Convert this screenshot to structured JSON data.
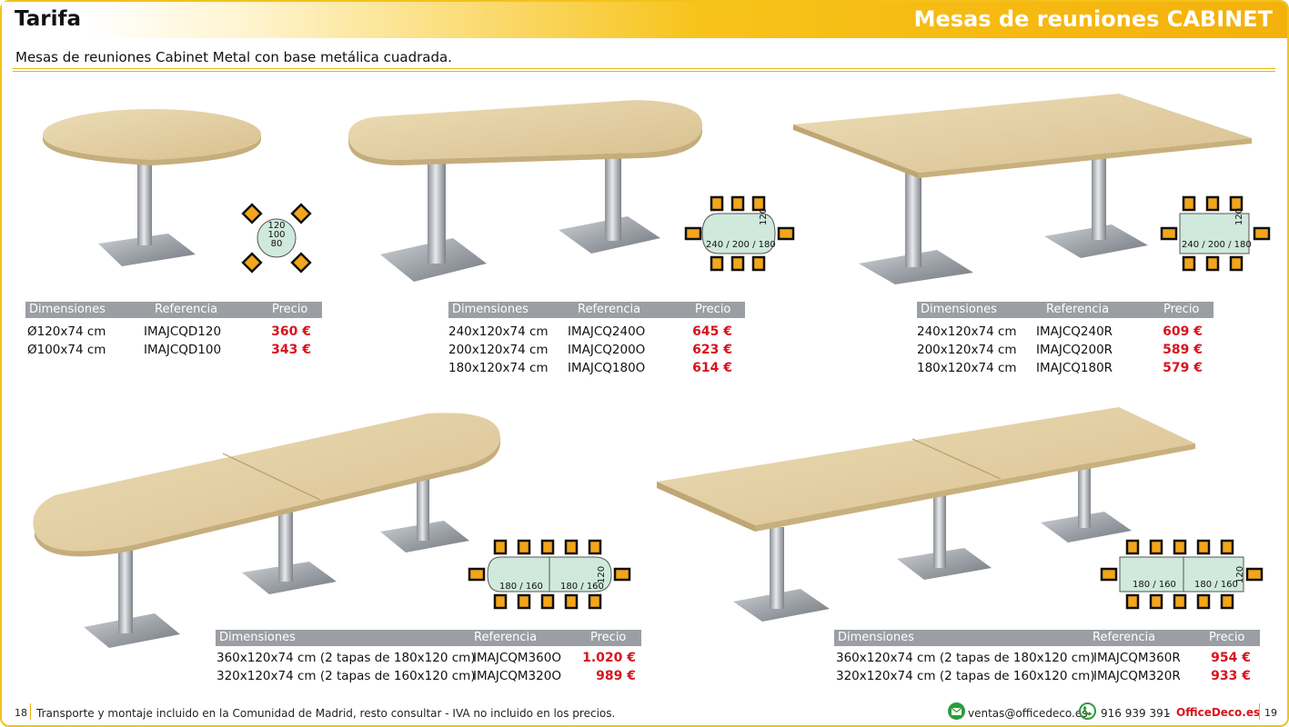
{
  "header": {
    "page_label": "Tarifa",
    "section_title": "Mesas de reuniones CABINET"
  },
  "subtitle": "Mesas de reuniones Cabinet Metal con base metálica cuadrada.",
  "table_headers": {
    "dimensions": "Dimensiones",
    "reference": "Referencia",
    "price": "Precio"
  },
  "products": [
    {
      "name": "round",
      "diagram_labels": [
        "120",
        "100",
        "80"
      ],
      "rows": [
        {
          "dim": "Ø120x74 cm",
          "ref": "IMAJCQD120",
          "price": "360 €"
        },
        {
          "dim": "Ø100x74 cm",
          "ref": "IMAJCQD100",
          "price": "343 €"
        }
      ]
    },
    {
      "name": "oval",
      "diagram_labels": [
        "240 / 200 / 180",
        "120"
      ],
      "rows": [
        {
          "dim": "240x120x74 cm",
          "ref": "IMAJCQ240O",
          "price": "645 €"
        },
        {
          "dim": "200x120x74 cm",
          "ref": "IMAJCQ200O",
          "price": "623 €"
        },
        {
          "dim": "180x120x74 cm",
          "ref": "IMAJCQ180O",
          "price": "614 €"
        }
      ]
    },
    {
      "name": "rectangular",
      "diagram_labels": [
        "240 / 200 / 180",
        "120"
      ],
      "rows": [
        {
          "dim": "240x120x74 cm",
          "ref": "IMAJCQ240R",
          "price": "609 €"
        },
        {
          "dim": "200x120x74 cm",
          "ref": "IMAJCQ200R",
          "price": "589 €"
        },
        {
          "dim": "180x120x74 cm",
          "ref": "IMAJCQ180R",
          "price": "579 €"
        }
      ]
    },
    {
      "name": "modular-oval",
      "diagram_labels": [
        "180 / 160",
        "180 / 160",
        "120"
      ],
      "rows": [
        {
          "dim": "360x120x74 cm (2 tapas de 180x120 cm)",
          "ref": "IMAJCQM360O",
          "price": "1.020 €"
        },
        {
          "dim": "320x120x74 cm (2 tapas de 160x120 cm)",
          "ref": "IMAJCQM320O",
          "price": "989 €"
        }
      ]
    },
    {
      "name": "modular-rectangular",
      "diagram_labels": [
        "180 / 160",
        "180 / 160",
        "120"
      ],
      "rows": [
        {
          "dim": "360x120x74 cm (2 tapas de 180x120 cm)",
          "ref": "IMAJCQM360R",
          "price": "954 €"
        },
        {
          "dim": "320x120x74 cm (2 tapas de 160x120 cm)",
          "ref": "IMAJCQM320R",
          "price": "933 €"
        }
      ]
    }
  ],
  "footer": {
    "page_left": "18",
    "note": "Transporte y montaje incluido en la Comunidad de Madrid, resto consultar - IVA no incluido en los precios.",
    "email": "ventas@officedeco.es",
    "phone": "916 939 391",
    "separator": "-",
    "brand": "OfficeDeco.es",
    "page_right": "19"
  },
  "colors": {
    "accent_yellow": "#f4b10b",
    "price_red": "#d7141d",
    "table_header_grey": "#9b9ea3",
    "table_top_wood": "#e2cfa2",
    "diagram_table_fill": "#cfe9dc",
    "chair_orange": "#f3a61b",
    "icon_green": "#2e9a3a"
  }
}
